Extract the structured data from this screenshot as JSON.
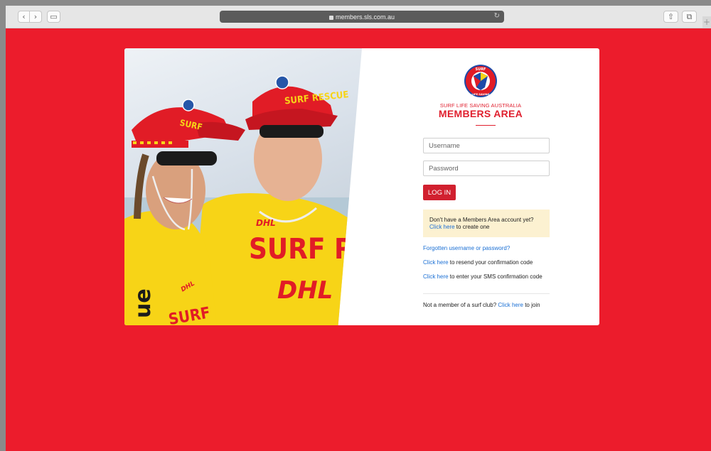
{
  "browser": {
    "url": "members.sls.com.au",
    "back_icon": "chevron-left-icon",
    "forward_icon": "chevron-right-icon",
    "back_glyph": "‹",
    "forward_glyph": "›",
    "sidebar_glyph": "▭",
    "reload_glyph": "↻",
    "share_glyph": "⇧",
    "tabs_glyph": "⧉",
    "new_tab_glyph": "+"
  },
  "logo": {
    "top_text": "SURF",
    "bottom_text": "LIFE SAVING"
  },
  "header": {
    "org_name": "SURF LIFE SAVING AUSTRALIA",
    "title": "MEMBERS AREA"
  },
  "form": {
    "username_placeholder": "Username",
    "password_placeholder": "Password",
    "login_label": "LOG IN"
  },
  "notice": {
    "text": "Don't have a Members Area account yet?",
    "link": "Click here",
    "suffix": " to create one"
  },
  "links": {
    "forgotten": "Forgotten username or password?",
    "resend_link": "Click here",
    "resend_suffix": " to resend your confirmation code",
    "sms_link": "Click here",
    "sms_suffix": " to enter your SMS confirmation code",
    "join_prefix": "Not a member of a surf club? ",
    "join_link": "Click here",
    "join_suffix": " to join"
  },
  "photo": {
    "cap_left": "SURF",
    "cap_right": "SURF RESCUE",
    "shirt_text": "SURF RESC",
    "sponsor": "DHL",
    "sleeve_text": "ue",
    "sleeve_text2": "SURF"
  },
  "colors": {
    "brand_red": "#ec1c2c",
    "button_red": "#d1202f",
    "link_blue": "#1a6fd4",
    "notice_bg": "#fcf1d1",
    "shirt_yellow": "#f7d417"
  }
}
